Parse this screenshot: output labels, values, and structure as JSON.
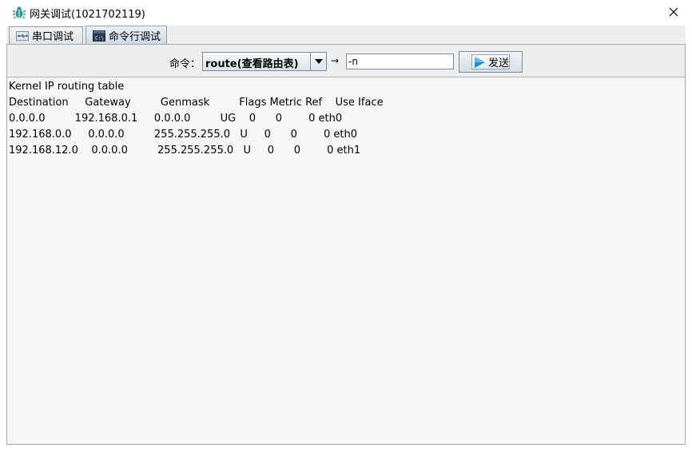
{
  "window": {
    "title": "网关调试(1021702119)",
    "icons": {
      "app": "bug-icon",
      "close": "close-icon"
    }
  },
  "tabs": [
    {
      "label": "串口调试",
      "icon": "usb-icon",
      "selected": false
    },
    {
      "label": "命令行调试",
      "icon": "terminal-icon",
      "selected": true
    }
  ],
  "toolbar": {
    "command_label": "命令：",
    "command_selected": "route(查看路由表)",
    "arrow": "→",
    "args_value": "-n",
    "send_label": "发送",
    "send_icon": "play-icon"
  },
  "output": {
    "lines": [
      "Kernel IP routing table",
      "Destination     Gateway         Genmask         Flags Metric Ref    Use Iface",
      "0.0.0.0         192.168.0.1     0.0.0.0         UG    0      0        0 eth0",
      "192.168.0.0     0.0.0.0         255.255.255.0   U     0      0        0 eth0",
      "192.168.12.0    0.0.0.0         255.255.255.0   U     0      0        0 eth1"
    ]
  },
  "colors": {
    "accent": "#2a9d8f",
    "send_icon": "#1a8fd8",
    "background": "#eeeeee"
  }
}
